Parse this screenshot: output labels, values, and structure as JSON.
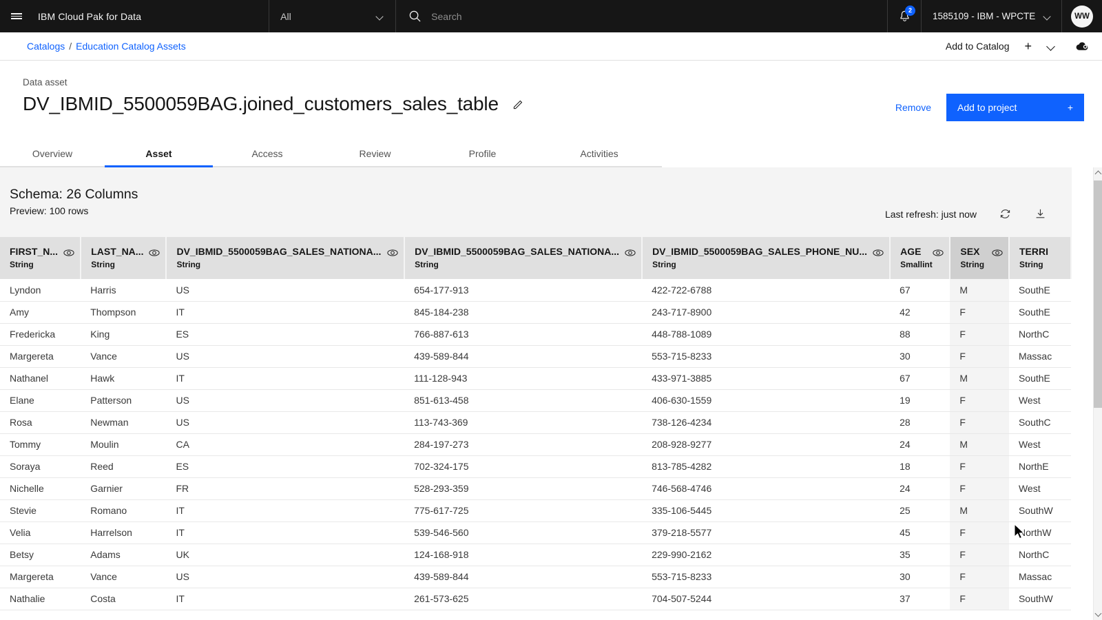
{
  "header": {
    "menu_icon": "hamburger-menu-icon",
    "brand": "IBM Cloud Pak for Data",
    "scope_label": "All",
    "search_placeholder": "Search",
    "search_icon": "search-icon",
    "notification_icon": "bell-icon",
    "notification_count": "2",
    "account_label": "1585109 - IBM - WPCTE",
    "avatar_initials": "WW"
  },
  "breadcrumb": {
    "items": [
      {
        "label": "Catalogs",
        "link": true
      },
      {
        "label": "/",
        "link": false
      },
      {
        "label": "Education Catalog Assets",
        "link": true
      }
    ],
    "add_to_catalog_label": "Add to Catalog",
    "plus_label": "+",
    "cloud_icon": "cloud-upload-icon"
  },
  "title_block": {
    "kicker": "Data asset",
    "title": "DV_IBMID_5500059BAG.joined_customers_sales_table",
    "edit_icon": "pencil-edit-icon",
    "remove_label": "Remove",
    "add_to_project_label": "Add to project",
    "add_to_project_plus": "+"
  },
  "tabs": [
    {
      "label": "Overview",
      "active": false
    },
    {
      "label": "Asset",
      "active": true
    },
    {
      "label": "Access",
      "active": false
    },
    {
      "label": "Review",
      "active": false
    },
    {
      "label": "Profile",
      "active": false
    },
    {
      "label": "Activities",
      "active": false
    }
  ],
  "schema": {
    "title": "Schema:  26 Columns",
    "preview": "Preview: 100 rows",
    "last_refresh": "Last refresh: just now",
    "refresh_icon": "refresh-icon",
    "download_icon": "download-icon"
  },
  "table": {
    "columns": [
      {
        "name": "FIRST_N...",
        "type": "String",
        "highlight": false,
        "eye_icon": "eye-icon"
      },
      {
        "name": "LAST_NA...",
        "type": "String",
        "highlight": false,
        "eye_icon": "eye-icon"
      },
      {
        "name": "DV_IBMID_5500059BAG_SALES_NATIONA...",
        "type": "String",
        "highlight": false,
        "eye_icon": "eye-icon"
      },
      {
        "name": "DV_IBMID_5500059BAG_SALES_NATIONA...",
        "type": "String",
        "highlight": false,
        "eye_icon": "eye-icon"
      },
      {
        "name": "DV_IBMID_5500059BAG_SALES_PHONE_NU...",
        "type": "String",
        "highlight": false,
        "eye_icon": "eye-icon"
      },
      {
        "name": "AGE",
        "type": "Smallint",
        "highlight": false,
        "eye_icon": "eye-icon"
      },
      {
        "name": "SEX",
        "type": "String",
        "highlight": true,
        "eye_icon": "eye-icon"
      },
      {
        "name": "TERRI",
        "type": "String",
        "highlight": false,
        "eye_icon": "eye-icon"
      }
    ],
    "rows": [
      [
        "Lyndon",
        "Harris",
        "US",
        "654-177-913",
        "422-722-6788",
        "67",
        "M",
        "SouthE"
      ],
      [
        "Amy",
        "Thompson",
        "IT",
        "845-184-238",
        "243-717-8900",
        "42",
        "F",
        "SouthE"
      ],
      [
        "Fredericka",
        "King",
        "ES",
        "766-887-613",
        "448-788-1089",
        "88",
        "F",
        "NorthC"
      ],
      [
        "Margereta",
        "Vance",
        "US",
        "439-589-844",
        "553-715-8233",
        "30",
        "F",
        "Massac"
      ],
      [
        "Nathanel",
        "Hawk",
        "IT",
        "111-128-943",
        "433-971-3885",
        "67",
        "M",
        "SouthE"
      ],
      [
        "Elane",
        "Patterson",
        "US",
        "851-613-458",
        "406-630-1559",
        "19",
        "F",
        "West"
      ],
      [
        "Rosa",
        "Newman",
        "US",
        "113-743-369",
        "738-126-4234",
        "28",
        "F",
        "SouthC"
      ],
      [
        "Tommy",
        "Moulin",
        "CA",
        "284-197-273",
        "208-928-9277",
        "24",
        "M",
        "West"
      ],
      [
        "Soraya",
        "Reed",
        "ES",
        "702-324-175",
        "813-785-4282",
        "18",
        "F",
        "NorthE"
      ],
      [
        "Nichelle",
        "Garnier",
        "FR",
        "528-293-359",
        "746-568-4746",
        "24",
        "F",
        "West"
      ],
      [
        "Stevie",
        "Romano",
        "IT",
        "775-617-725",
        "335-106-5445",
        "25",
        "M",
        "SouthW"
      ],
      [
        "Velia",
        "Harrelson",
        "IT",
        "539-546-560",
        "379-218-5577",
        "45",
        "F",
        "NorthW"
      ],
      [
        "Betsy",
        "Adams",
        "UK",
        "124-168-918",
        "229-990-2162",
        "35",
        "F",
        "NorthC"
      ],
      [
        "Margereta",
        "Vance",
        "US",
        "439-589-844",
        "553-715-8233",
        "30",
        "F",
        "Massac"
      ],
      [
        "Nathalie",
        "Costa",
        "IT",
        "261-573-625",
        "704-507-5244",
        "37",
        "F",
        "SouthW"
      ]
    ]
  },
  "colors": {
    "accent": "#0f62fe",
    "header_bg": "#161616",
    "panel_bg": "#f4f4f4",
    "th_bg": "#e0e0e0",
    "th_highlight": "#cfcfcf"
  }
}
